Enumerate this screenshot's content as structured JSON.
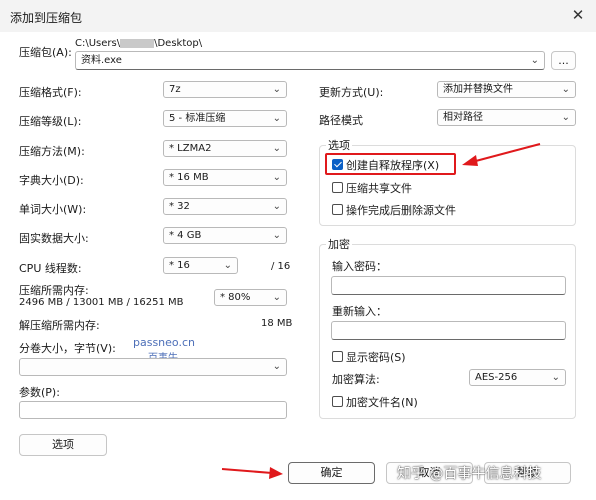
{
  "window": {
    "title": "添加到压缩包",
    "close_glyph": "✕"
  },
  "archive": {
    "label": "压缩包(A):",
    "path_prefix": "C:\\Users\\",
    "path_suffix": "\\Desktop\\",
    "filename": "资料.exe",
    "browse_label": "..."
  },
  "left": {
    "format_label": "压缩格式(F):",
    "format_value": "7z",
    "level_label": "压缩等级(L):",
    "level_value": "5 - 标准压缩",
    "method_label": "压缩方法(M):",
    "method_value": "* LZMA2",
    "dict_label": "字典大小(D):",
    "dict_value": "* 16 MB",
    "word_label": "单词大小(W):",
    "word_value": "* 32",
    "solid_label": "固实数据大小:",
    "solid_value": "* 4 GB",
    "threads_label": "CPU 线程数:",
    "threads_value": "* 16",
    "threads_total": "/ 16",
    "mem_label": "压缩所需内存:",
    "mem_detail": "2496 MB / 13001 MB / 16251 MB",
    "mem_value": "* 80%",
    "decomp_label": "解压缩所需内存:",
    "decomp_value": "18 MB",
    "split_label": "分卷大小，字节(V):",
    "split_value": "",
    "params_label": "参数(P):",
    "params_value": "",
    "options_button": "选项"
  },
  "right": {
    "update_label": "更新方式(U):",
    "update_value": "添加并替换文件",
    "path_mode_label": "路径模式",
    "path_mode_value": "相对路径",
    "options_group": "选项",
    "opt_sfx": "创建自释放程序(X)",
    "opt_sfx_checked": true,
    "opt_shared": "压缩共享文件",
    "opt_shared_checked": false,
    "opt_delete": "操作完成后删除源文件",
    "opt_delete_checked": false,
    "enc_group": "加密",
    "enc_password_label": "输入密码：",
    "enc_password_value": "",
    "enc_reenter_label": "重新输入：",
    "enc_reenter_value": "",
    "enc_show_label": "显示密码(S)",
    "enc_show_checked": false,
    "enc_method_label": "加密算法:",
    "enc_method_value": "AES-256",
    "enc_names_label": "加密文件名(N)",
    "enc_names_checked": false
  },
  "footer": {
    "ok": "确定",
    "cancel": "取消",
    "help": "帮助"
  },
  "watermarks": {
    "site": "passneo.cn",
    "site_cn": "百事牛",
    "footer": "知乎 @百事牛信息科技"
  },
  "colors": {
    "accent": "#0a5fc6",
    "annotation_red": "#e0191c"
  },
  "icons": {
    "dropdown": "chevron-down-icon",
    "check": "check-icon",
    "arrow": "red-arrow-annotation"
  }
}
